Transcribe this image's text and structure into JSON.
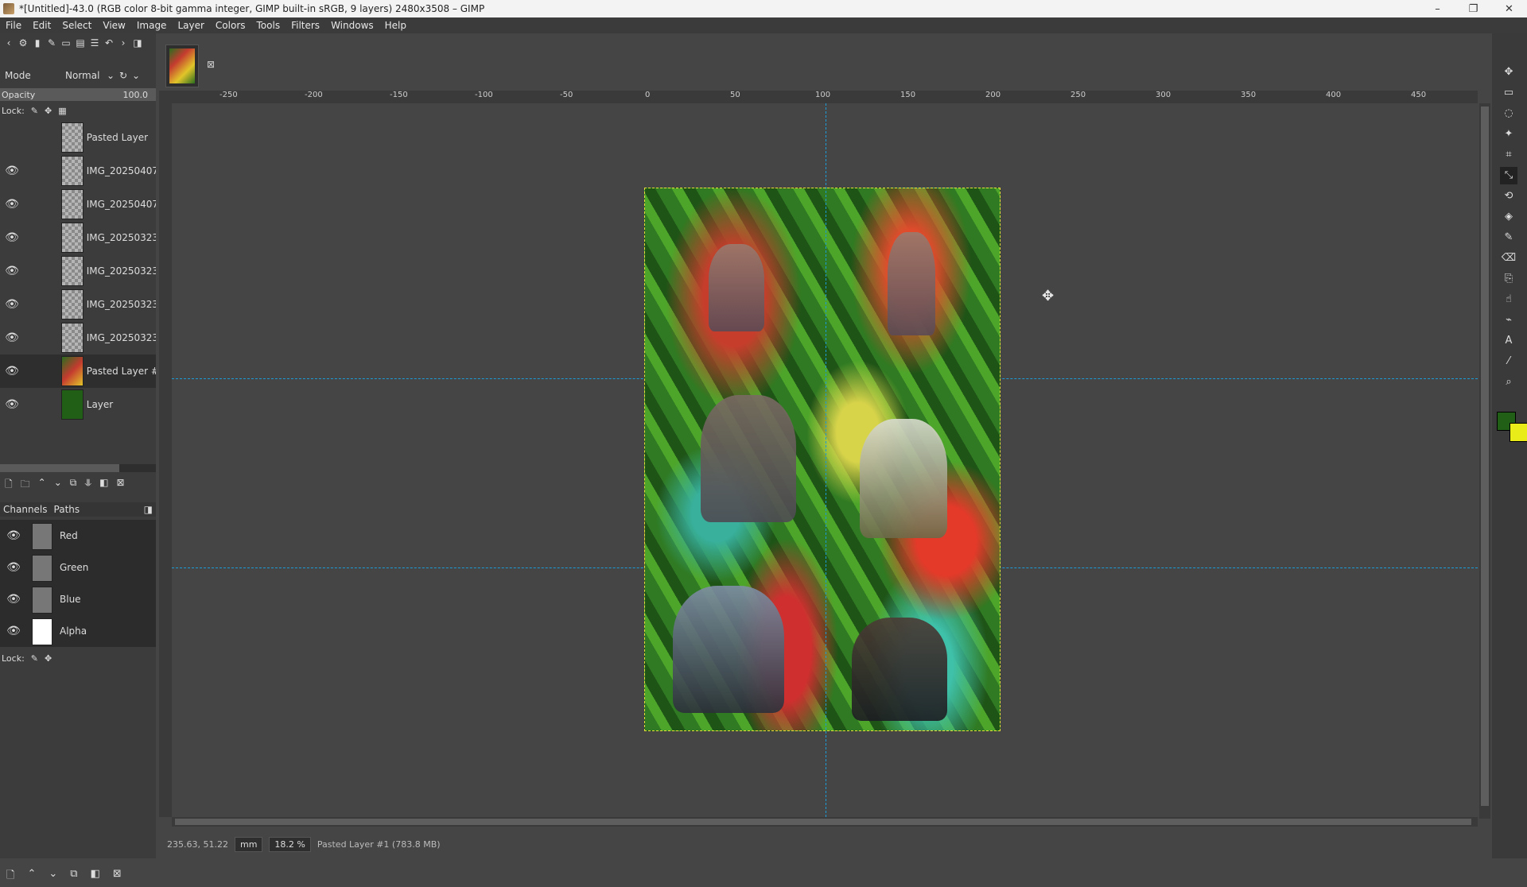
{
  "window": {
    "title": "*[Untitled]-43.0 (RGB color 8-bit gamma integer, GIMP built-in sRGB, 9 layers) 2480x3508 – GIMP",
    "controls": [
      "–",
      "❐",
      "✕"
    ]
  },
  "menu": [
    "File",
    "Edit",
    "Select",
    "View",
    "Image",
    "Layer",
    "Colors",
    "Tools",
    "Filters",
    "Windows",
    "Help"
  ],
  "layers_panel": {
    "mode_label": "Mode",
    "mode_value": "Normal",
    "opacity_label": "Opacity",
    "opacity_value": "100.0",
    "lock_label": "Lock:",
    "layers": [
      {
        "name": "Pasted Layer",
        "visible": false
      },
      {
        "name": "IMG_20250407_",
        "visible": true
      },
      {
        "name": "IMG_20250407_",
        "visible": true
      },
      {
        "name": "IMG_20250323_",
        "visible": true
      },
      {
        "name": "IMG_20250323_",
        "visible": true
      },
      {
        "name": "IMG_20250323_",
        "visible": true
      },
      {
        "name": "IMG_20250323_",
        "visible": true
      },
      {
        "name": "Pasted Layer #",
        "visible": true,
        "active": true
      },
      {
        "name": "Layer",
        "visible": true
      }
    ]
  },
  "channels_panel": {
    "tabs": [
      "Channels",
      "Paths"
    ],
    "channels": [
      "Red",
      "Green",
      "Blue",
      "Alpha"
    ],
    "lock_label": "Lock:"
  },
  "rulers": {
    "horizontal": [
      "-250",
      "-200",
      "-150",
      "-100",
      "-50",
      "0",
      "50",
      "100",
      "150",
      "200",
      "250",
      "300",
      "350",
      "400",
      "450"
    ]
  },
  "status": {
    "coords": "235.63, 51.22",
    "unit": "mm",
    "zoom": "18.2 %",
    "message": "Pasted Layer #1 (783.8 MB)"
  },
  "colors": {
    "foreground": "#205f15",
    "background": "#e9ec19",
    "guide": "#1d9bd6",
    "selection": "#e6dc3a"
  }
}
